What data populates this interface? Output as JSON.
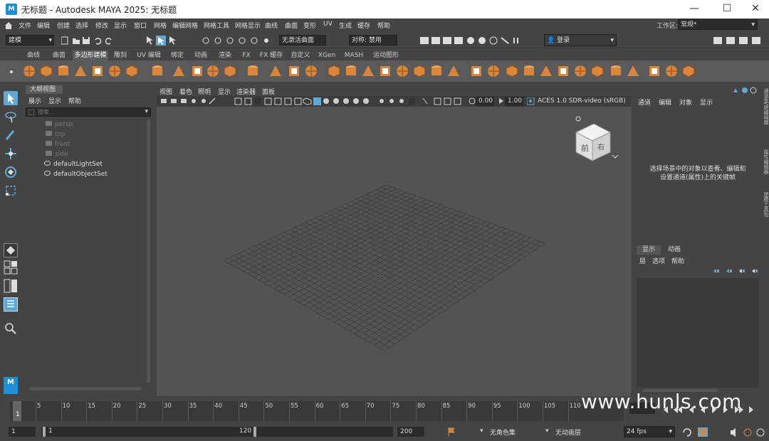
{
  "title_bar": {
    "title": "无标题 - Autodesk MAYA 2025: 无标题",
    "logo": "M",
    "minimize": "—",
    "maximize": "☐",
    "close": "✕"
  },
  "menu": [
    "文件",
    "编辑",
    "创建",
    "选择",
    "修改",
    "显示",
    "窗口",
    "网格",
    "编辑网格",
    "网格工具",
    "网格显示",
    "曲线",
    "曲面",
    "变形",
    "UV",
    "生成",
    "缓存",
    "帮助"
  ],
  "workspace": {
    "label": "工作区:",
    "value": "常规*"
  },
  "status_line": {
    "mode": "建模",
    "no_live_surface": "无激活曲面",
    "symmetry": "对称: 禁用",
    "login": "登录"
  },
  "shelf_tabs": [
    "曲线",
    "曲面",
    "多边形建模",
    "雕刻",
    "UV 编辑",
    "绑定",
    "动画",
    "渲染",
    "FX",
    "FX 缓存",
    "自定义",
    "XGen",
    "MASH",
    "运动图形"
  ],
  "shelf_active": "多边形建模",
  "outliner": {
    "title": "大纲视图",
    "menu": [
      "展示",
      "显示",
      "帮助"
    ],
    "search_placeholder": "搜索...",
    "items": [
      "persp",
      "top",
      "front",
      "side",
      "defaultLightSet",
      "defaultObjectSet"
    ]
  },
  "viewport": {
    "menu": [
      "视图",
      "着色",
      "照明",
      "显示",
      "渲染器",
      "面板"
    ],
    "exposure": "0.00",
    "gamma": "1.00",
    "color_space": "ACES 1.0 SDR-video (sRGB)",
    "viewcube_front": "前",
    "viewcube_right": "右"
  },
  "channel_box": {
    "menu": [
      "通道",
      "编辑",
      "对象",
      "显示"
    ],
    "hint": "选择场景中的对象以查看、编辑和设置通道(属性)上的关键帧"
  },
  "layer_editor": {
    "tabs": [
      "显示",
      "动画"
    ],
    "menu": [
      "层",
      "选项",
      "帮助"
    ]
  },
  "side_tabs": [
    "通道盒/层编辑器",
    "属性编辑器",
    "建模工具包"
  ],
  "timeline": {
    "ticks": [
      "5",
      "10",
      "15",
      "20",
      "25",
      "30",
      "35",
      "40",
      "45",
      "50",
      "55",
      "60",
      "65",
      "70",
      "75",
      "80",
      "85",
      "90",
      "95",
      "100",
      "105",
      "110"
    ],
    "current": "1"
  },
  "range": {
    "start": "1",
    "inner_start": "1",
    "inner_end": "120",
    "end": "200",
    "char_set": "无角色集",
    "anim_layer": "无动画层",
    "fps": "24 fps"
  },
  "watermark": "www.hunls.com",
  "colors": {
    "accent": "#5fa8d3",
    "shelf_orange": "#d8863b"
  }
}
